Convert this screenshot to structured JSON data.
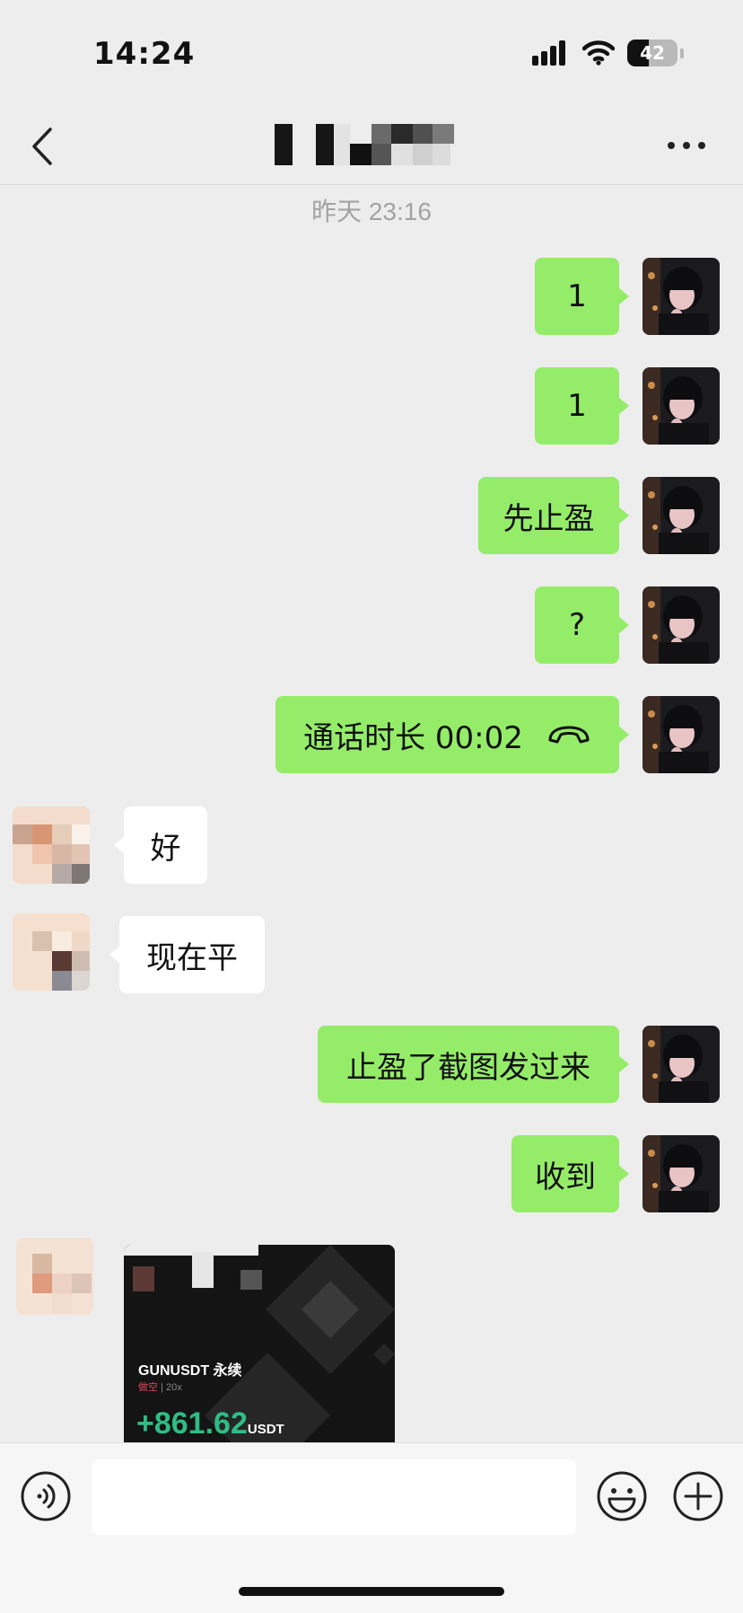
{
  "status_bar": {
    "time": "14:24",
    "battery": "42"
  },
  "nav": {
    "title": ""
  },
  "timestamp": "昨天 23:16",
  "messages": {
    "m1": "1",
    "m2": "1",
    "m3": "先止盈",
    "m4": "?",
    "m5_call": "通话时长 00:02",
    "m6": "好",
    "m7": "现在平",
    "m8": "止盈了截图发过来",
    "m9": "收到"
  },
  "card": {
    "symbol": "GUNUSDT 永续",
    "side": "做空",
    "leverage": "20x",
    "pnl": "+861.62",
    "pnl_unit": "USDT"
  },
  "input_bar": {
    "placeholder": ""
  },
  "colors": {
    "background": "#ededed",
    "outgoing_bubble": "#95ec69",
    "incoming_bubble": "#ffffff",
    "pnl_green": "#2ebd85"
  },
  "icons": {
    "back": "chevron-left-icon",
    "more": "more-dots-icon",
    "voice": "voice-icon",
    "emoji": "emoji-icon",
    "plus": "plus-icon",
    "call": "hangup-phone-icon"
  }
}
